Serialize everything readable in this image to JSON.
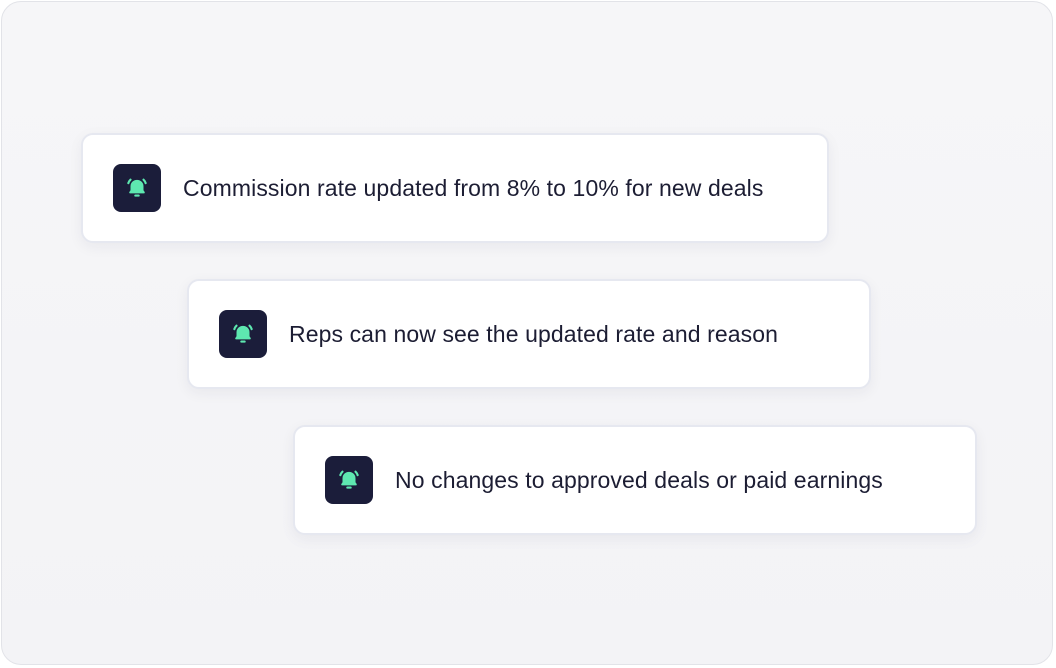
{
  "theme": {
    "icon_tile_color": "#1b1d3a",
    "icon_color": "#5ee8b0",
    "text_color": "#1c1d33"
  },
  "notifications": [
    {
      "icon": "bell-ringing-icon",
      "text": "Commission rate updated from 8% to 10% for new deals"
    },
    {
      "icon": "bell-ringing-icon",
      "text": "Reps can now see the updated rate and reason"
    },
    {
      "icon": "bell-ringing-icon",
      "text": "No changes to approved deals or paid earnings"
    }
  ]
}
